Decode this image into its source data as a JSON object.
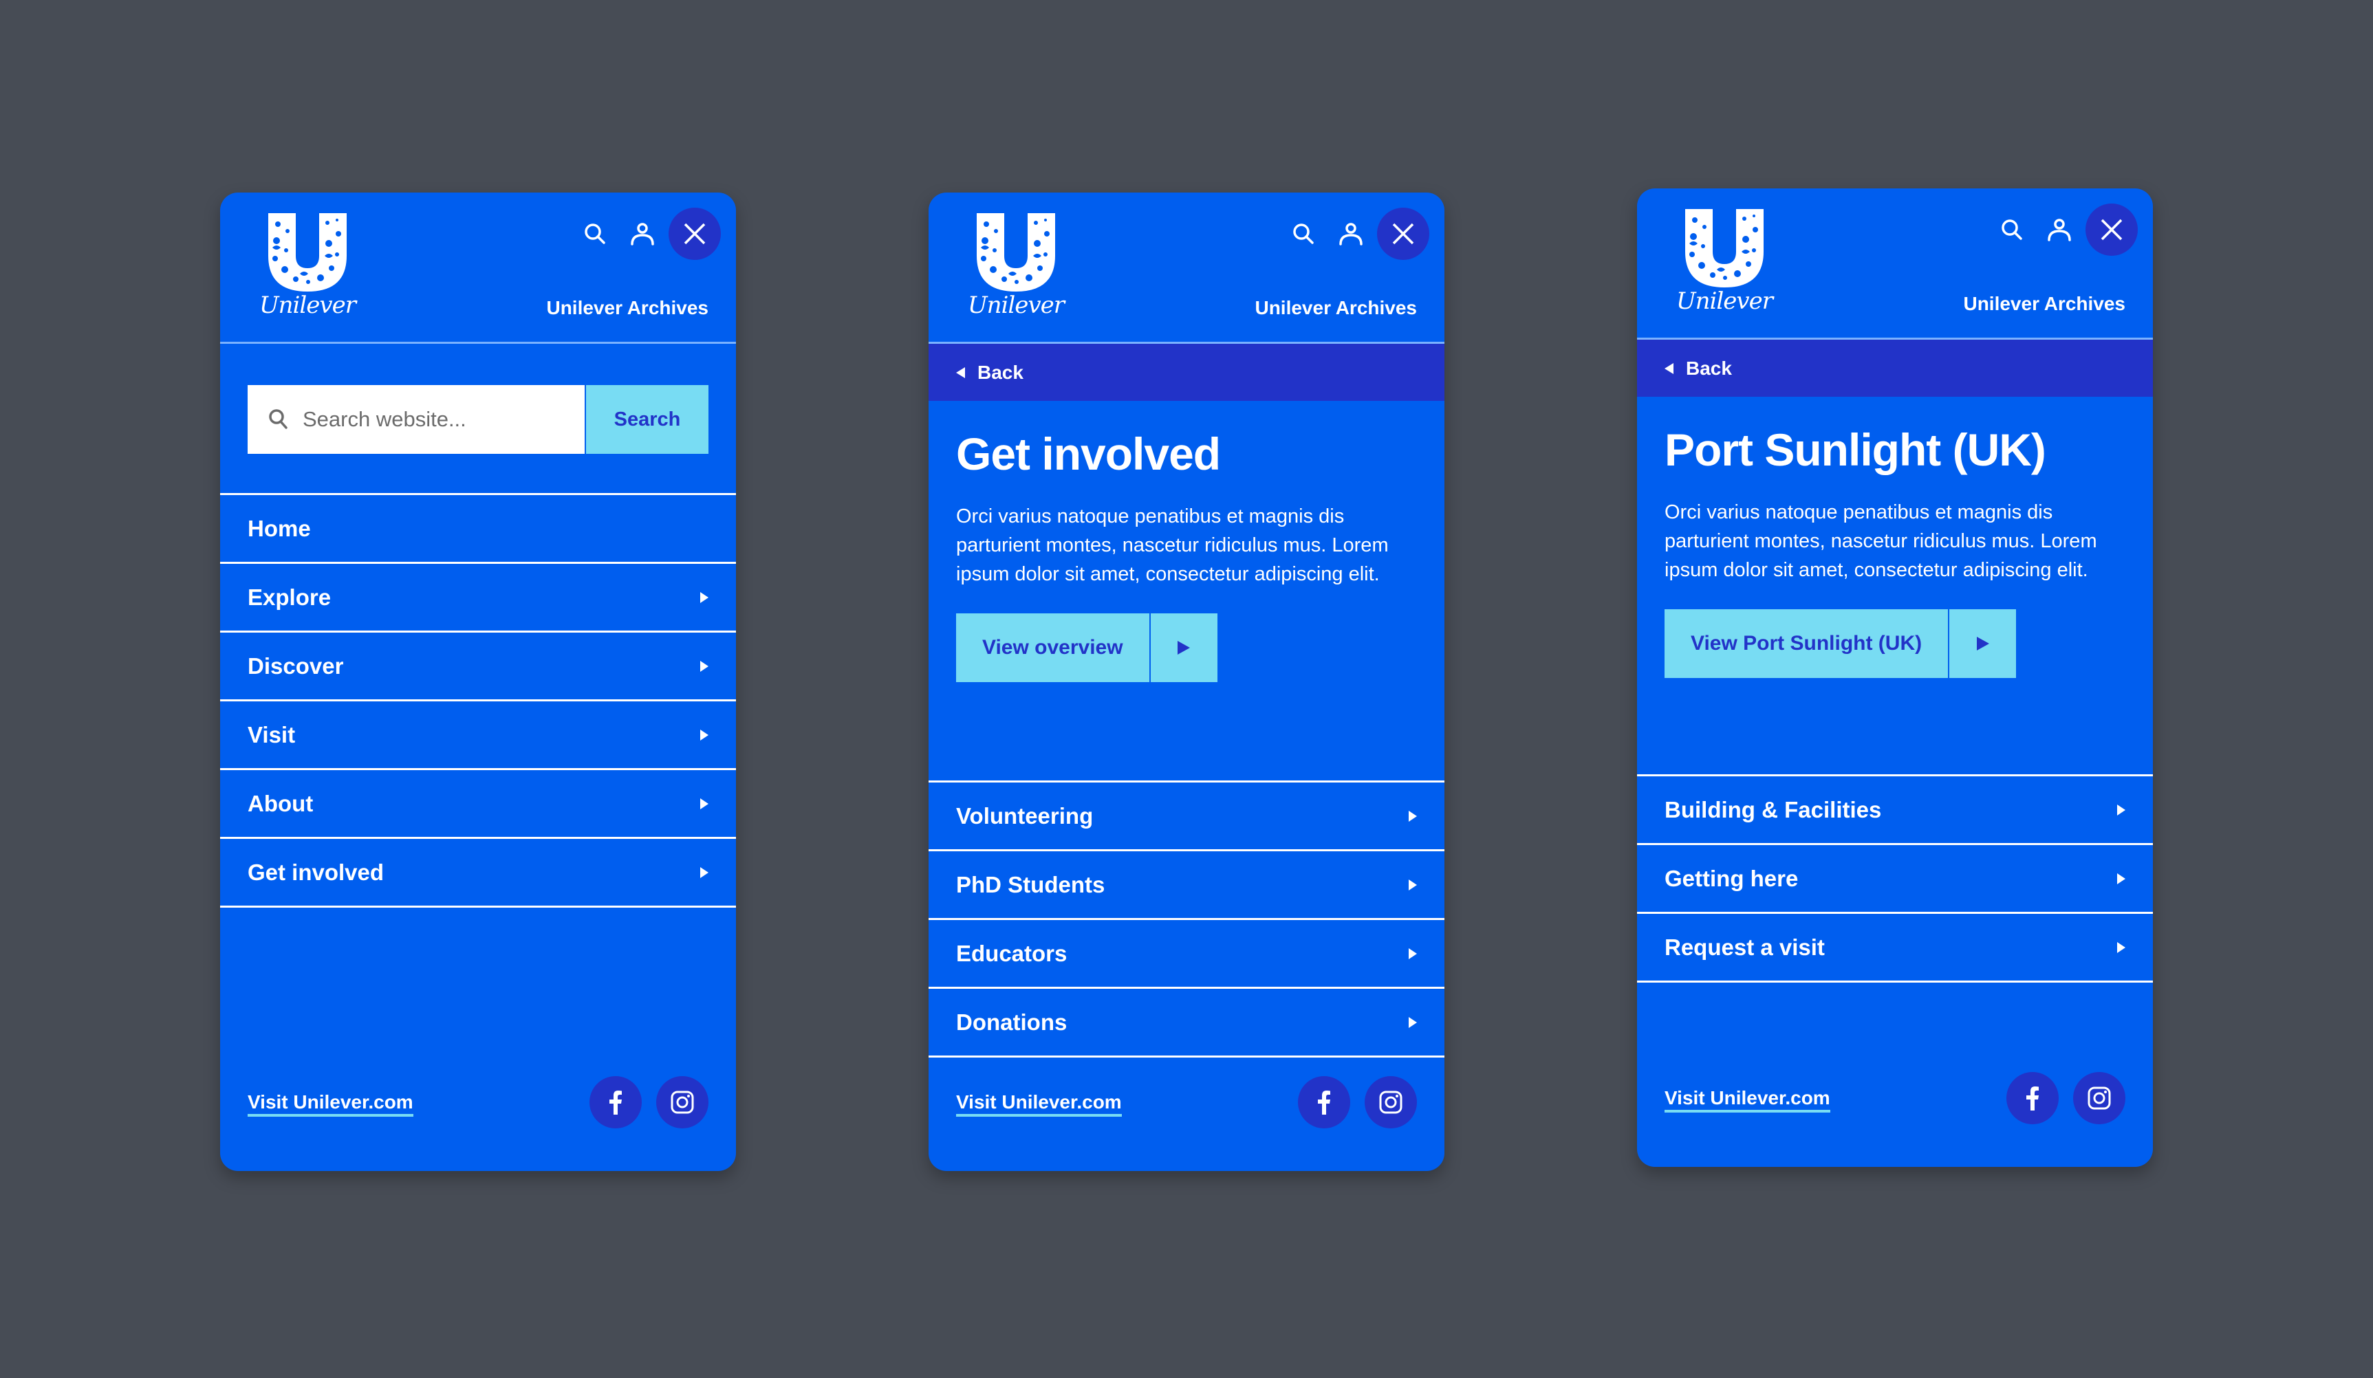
{
  "colors": {
    "background": "#474c55",
    "brand_blue": "#005eef",
    "dark_blue": "#2233c8",
    "accent_cyan": "#78dcf3",
    "divider": "#7ab2ff"
  },
  "header": {
    "logo_wordmark": "Unilever",
    "site_title": "Unilever Archives",
    "icons": [
      "search-icon",
      "user-icon",
      "close-icon"
    ]
  },
  "footer": {
    "visit_link": "Visit Unilever.com",
    "social": [
      "facebook-icon",
      "instagram-icon"
    ]
  },
  "panels": [
    {
      "search": {
        "placeholder": "Search website...",
        "value": "",
        "button_label": "Search"
      },
      "menu": [
        {
          "label": "Home",
          "has_submenu": false
        },
        {
          "label": "Explore",
          "has_submenu": true
        },
        {
          "label": "Discover",
          "has_submenu": true
        },
        {
          "label": "Visit",
          "has_submenu": true
        },
        {
          "label": "About",
          "has_submenu": true
        },
        {
          "label": "Get involved",
          "has_submenu": true
        }
      ]
    },
    {
      "back_label": "Back",
      "title": "Get involved",
      "description": "Orci varius natoque penatibus et magnis dis parturient montes, nascetur ridiculus mus. Lorem ipsum dolor sit amet, consectetur adipiscing elit.",
      "cta_label": "View overview",
      "menu": [
        {
          "label": "Volunteering",
          "has_submenu": true
        },
        {
          "label": "PhD Students",
          "has_submenu": true
        },
        {
          "label": "Educators",
          "has_submenu": true
        },
        {
          "label": "Donations",
          "has_submenu": true
        }
      ]
    },
    {
      "back_label": "Back",
      "title": "Port Sunlight (UK)",
      "description": "Orci varius natoque penatibus et magnis dis parturient montes, nascetur ridiculus mus. Lorem ipsum dolor sit amet, consectetur adipiscing elit.",
      "cta_label": "View Port Sunlight (UK)",
      "menu": [
        {
          "label": "Building & Facilities",
          "has_submenu": true
        },
        {
          "label": "Getting here",
          "has_submenu": true
        },
        {
          "label": "Request a visit",
          "has_submenu": true
        }
      ]
    }
  ]
}
